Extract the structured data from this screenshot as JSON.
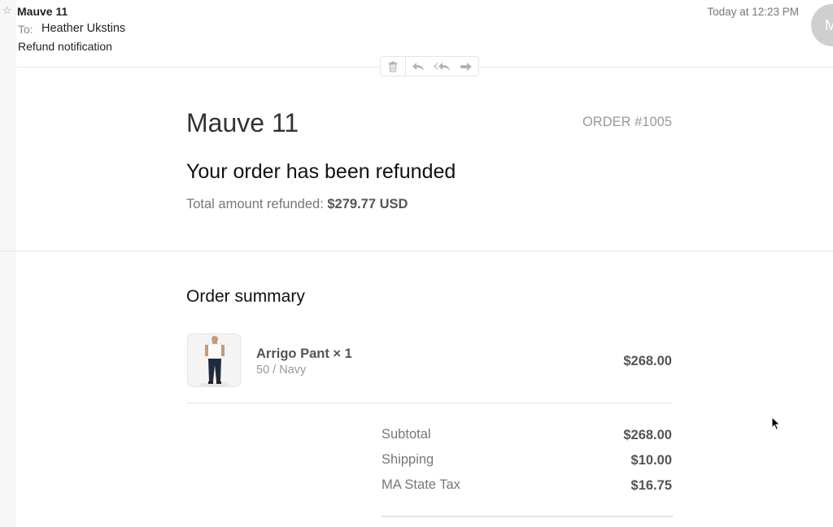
{
  "mail": {
    "sender": "Mauve 11",
    "to_label": "To:",
    "to_name": "Heather Ukstins",
    "subject": "Refund notification",
    "timestamp": "Today at 12:23 PM",
    "avatar_initial": "M",
    "toolbar": [
      "trash-icon",
      "reply-icon",
      "reply-all-icon",
      "forward-icon"
    ]
  },
  "email": {
    "shop_name": "Mauve 11",
    "order_number": "ORDER #1005",
    "heading": "Your order has been refunded",
    "refund_label": "Total amount refunded:",
    "refund_amount": "$279.77 USD",
    "summary_title": "Order summary",
    "item": {
      "name": "Arrigo Pant × 1",
      "variant": "50 / Navy",
      "price": "$268.00"
    },
    "totals": [
      {
        "label": "Subtotal",
        "value": "$268.00"
      },
      {
        "label": "Shipping",
        "value": "$10.00"
      },
      {
        "label": "MA State Tax",
        "value": "$16.75"
      }
    ]
  }
}
